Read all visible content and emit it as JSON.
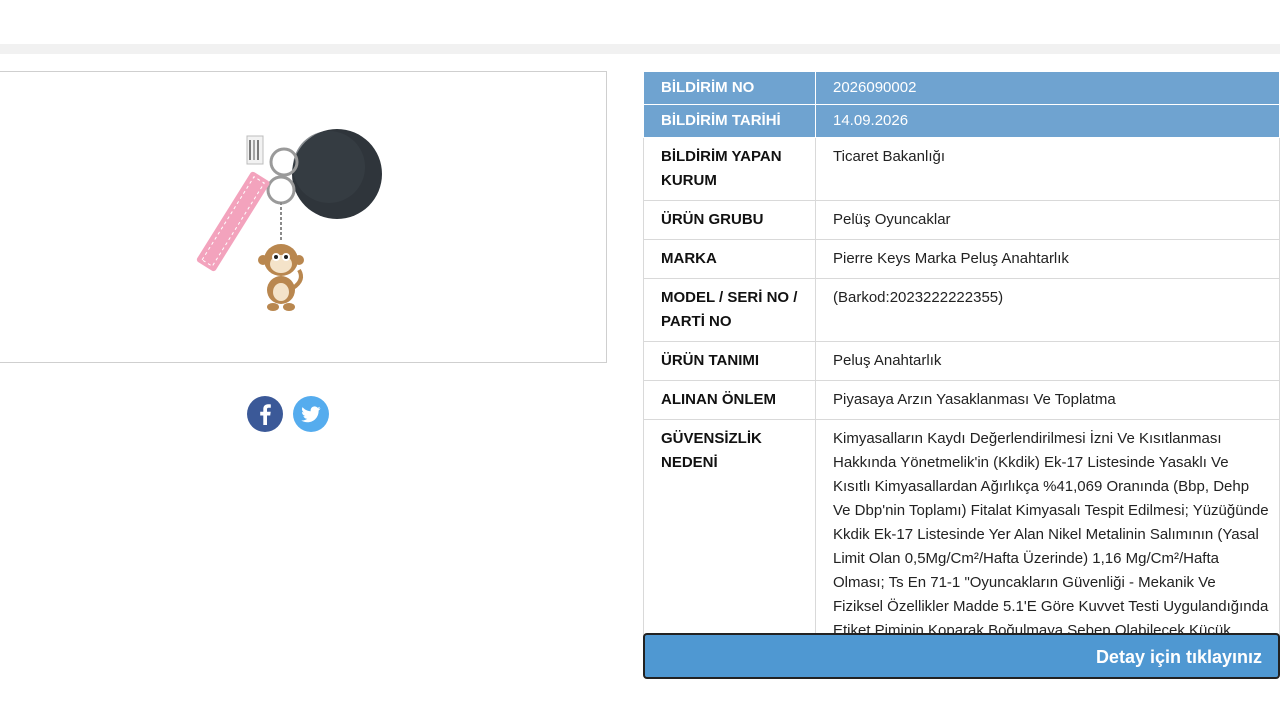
{
  "product": {
    "image_alt": "Pelüş anahtarlık görseli"
  },
  "social": {
    "facebook_icon": "facebook-icon",
    "twitter_icon": "twitter-icon"
  },
  "details": {
    "rows": [
      {
        "label": "BİLDİRİM NO",
        "value": "2026090002"
      },
      {
        "label": "BİLDİRİM TARİHİ",
        "value": "14.09.2026"
      },
      {
        "label": "BİLDİRİM YAPAN KURUM",
        "value": "Ticaret Bakanlığı"
      },
      {
        "label": "ÜRÜN GRUBU",
        "value": "Pelüş Oyuncaklar"
      },
      {
        "label": "MARKA",
        "value": "Pierre Keys Marka Peluş Anahtarlık"
      },
      {
        "label": "MODEL / SERİ NO / PARTİ NO",
        "value": "(Barkod:2023222222355)"
      },
      {
        "label": "ÜRÜN TANIMI",
        "value": "Peluş Anahtarlık"
      },
      {
        "label": "ALINAN ÖNLEM",
        "value": "Piyasaya Arzın Yasaklanması Ve Toplatma"
      },
      {
        "label": "GÜVENSİZLİK NEDENİ",
        "value": "Kimyasalların Kaydı Değerlendirilmesi İzni Ve Kısıtlanması Hakkında Yönetmelik'in (Kkdik) Ek-17 Listesinde Yasaklı Ve Kısıtlı Kimyasallardan Ağırlıkça %41,069 Oranında (Bbp, Dehp Ve Dbp'nin Toplamı) Fitalat Kimyasalı Tespit Edilmesi; Yüzüğünde Kkdik Ek-17 Listesinde Yer Alan Nikel Metalinin Salımının (Yasal Limit Olan 0,5Mg/Cm²/Hafta Üzerinde) 1,16 Mg/Cm²/Hafta Olması; Ts En 71-1 \"Oyuncakların Güvenliği - Mekanik Ve Fiziksel Özellikler Madde 5.1'E Göre Kuvvet Testi Uygulandığında Etiket Piminin Koparak Boğulmaya Sebep Olabilecek Küçük Parça Oluşması,"
      }
    ]
  },
  "detail_button": {
    "label": "Detay için tıklayınız"
  },
  "colors": {
    "highlight_row": "#6fa3d0",
    "button": "#4f98d2",
    "facebook": "#3b5998",
    "twitter": "#55acee"
  }
}
